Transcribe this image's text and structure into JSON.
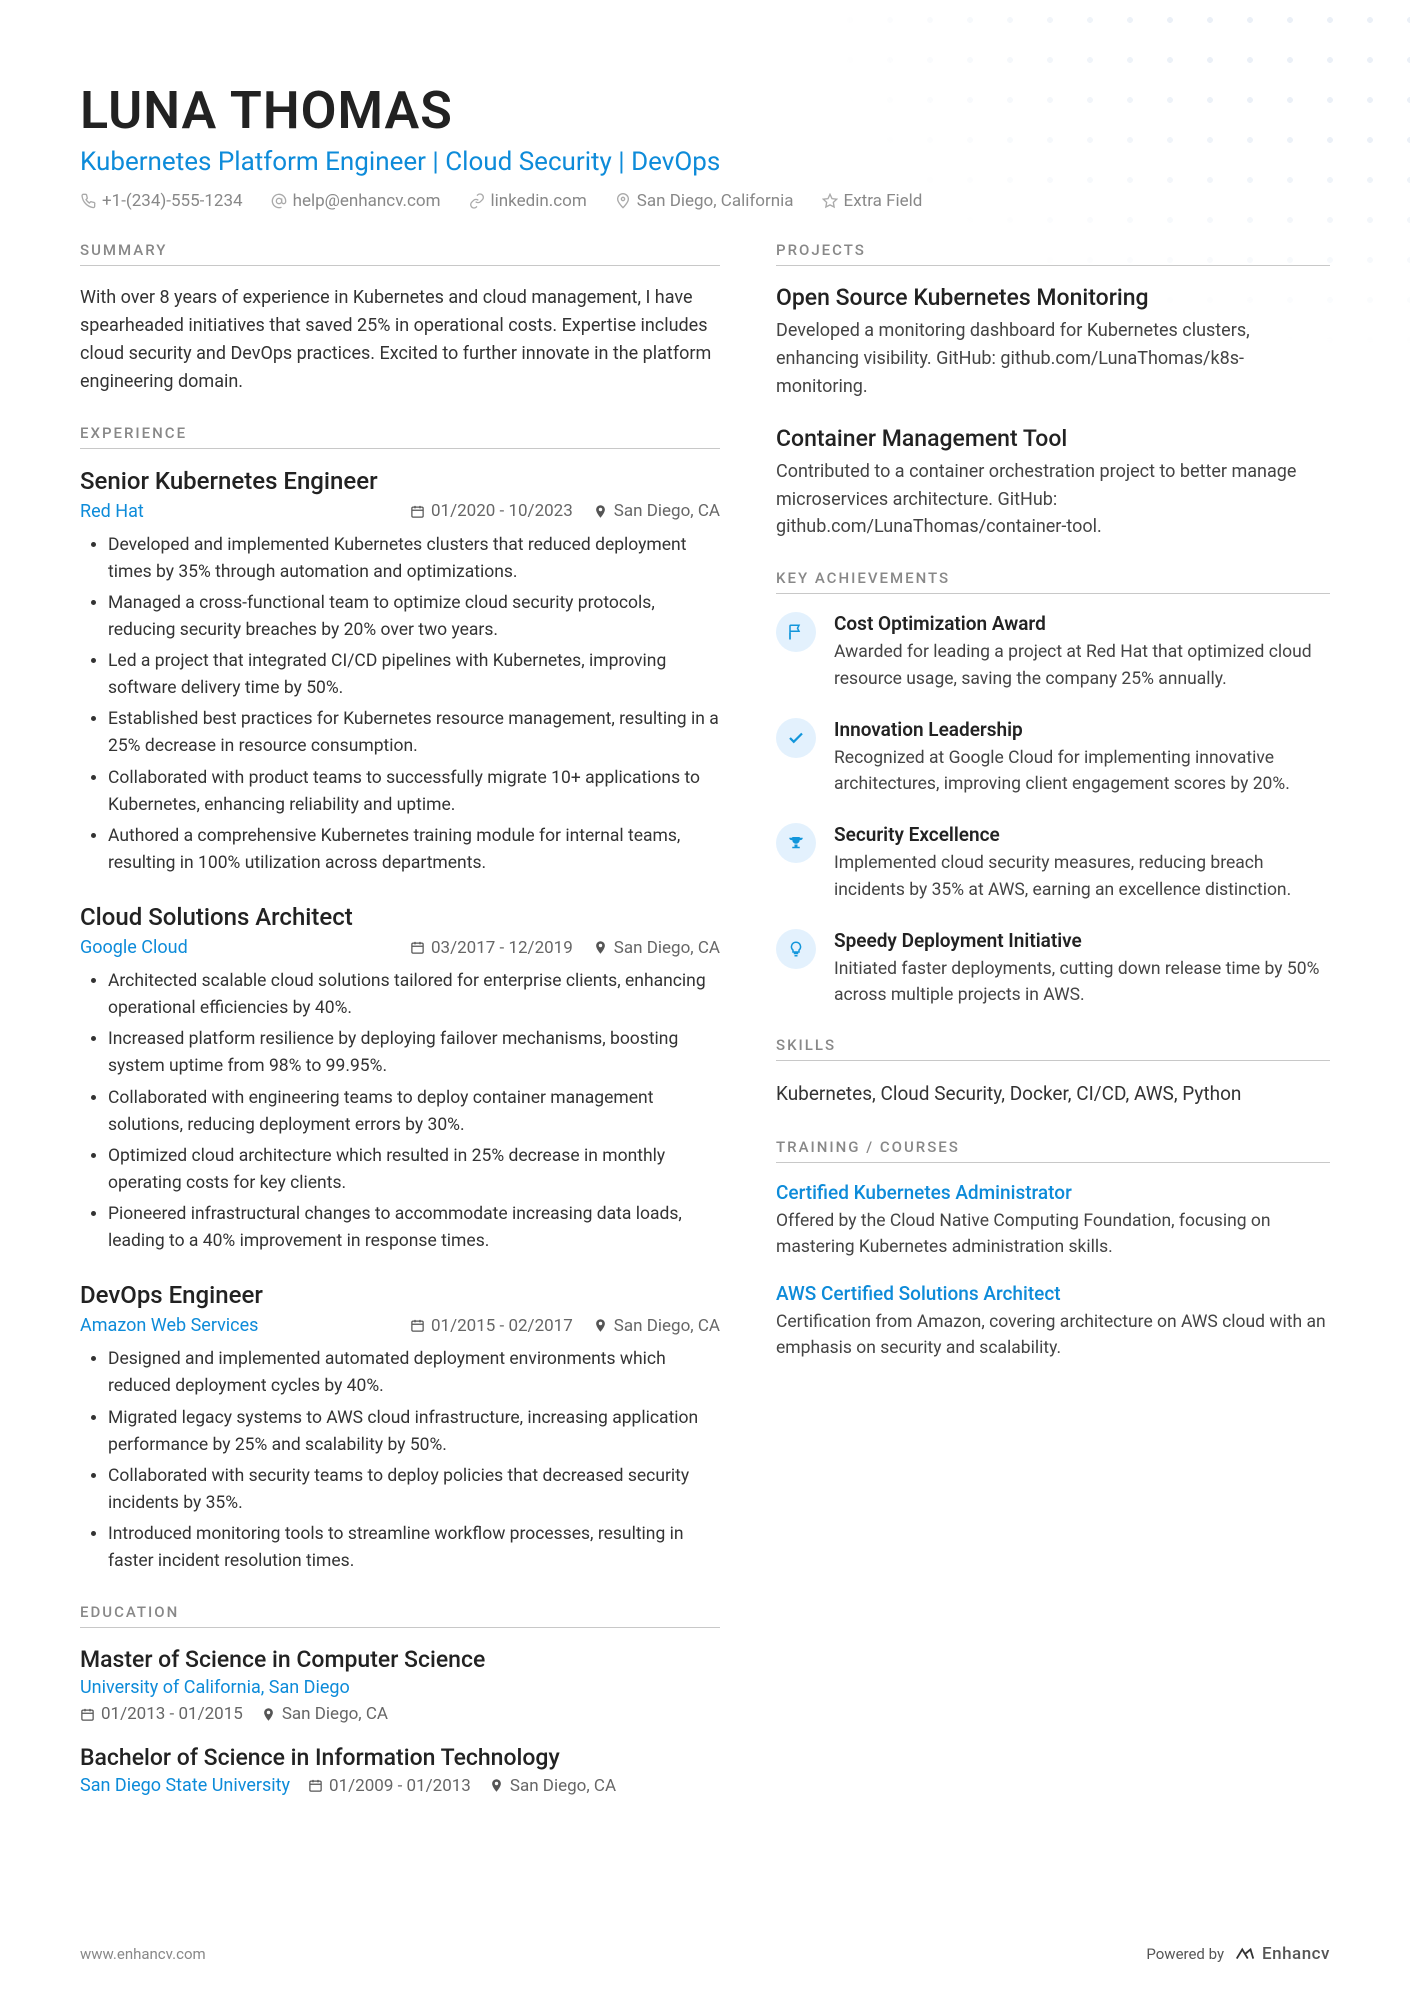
{
  "header": {
    "name": "LUNA THOMAS",
    "subtitle": "Kubernetes Platform Engineer | Cloud Security | DevOps",
    "contacts": {
      "phone": "+1-(234)-555-1234",
      "email": "help@enhancv.com",
      "linkedin": "linkedin.com",
      "location": "San Diego, California",
      "extra": "Extra Field"
    }
  },
  "sections": {
    "summary_label": "SUMMARY",
    "experience_label": "EXPERIENCE",
    "education_label": "EDUCATION",
    "projects_label": "PROJECTS",
    "achievements_label": "KEY ACHIEVEMENTS",
    "skills_label": "SKILLS",
    "training_label": "TRAINING / COURSES"
  },
  "summary": "With over 8 years of experience in Kubernetes and cloud management, I have spearheaded initiatives that saved 25% in operational costs. Expertise includes cloud security and DevOps practices. Excited to further innovate in the platform engineering domain.",
  "experience": [
    {
      "title": "Senior Kubernetes Engineer",
      "company": "Red Hat",
      "dates": "01/2020 - 10/2023",
      "location": "San Diego, CA",
      "bullets": [
        "Developed and implemented Kubernetes clusters that reduced deployment times by 35% through automation and optimizations.",
        "Managed a cross-functional team to optimize cloud security protocols, reducing security breaches by 20% over two years.",
        "Led a project that integrated CI/CD pipelines with Kubernetes, improving software delivery time by 50%.",
        "Established best practices for Kubernetes resource management, resulting in a 25% decrease in resource consumption.",
        "Collaborated with product teams to successfully migrate 10+ applications to Kubernetes, enhancing reliability and uptime.",
        "Authored a comprehensive Kubernetes training module for internal teams, resulting in 100% utilization across departments."
      ]
    },
    {
      "title": "Cloud Solutions Architect",
      "company": "Google Cloud",
      "dates": "03/2017 - 12/2019",
      "location": "San Diego, CA",
      "bullets": [
        "Architected scalable cloud solutions tailored for enterprise clients, enhancing operational efficiencies by 40%.",
        "Increased platform resilience by deploying failover mechanisms, boosting system uptime from 98% to 99.95%.",
        "Collaborated with engineering teams to deploy container management solutions, reducing deployment errors by 30%.",
        "Optimized cloud architecture which resulted in 25% decrease in monthly operating costs for key clients.",
        "Pioneered infrastructural changes to accommodate increasing data loads, leading to a 40% improvement in response times."
      ]
    },
    {
      "title": "DevOps Engineer",
      "company": "Amazon Web Services",
      "dates": "01/2015 - 02/2017",
      "location": "San Diego, CA",
      "bullets": [
        "Designed and implemented automated deployment environments which reduced deployment cycles by 40%.",
        "Migrated legacy systems to AWS cloud infrastructure, increasing application performance by 25% and scalability by 50%.",
        "Collaborated with security teams to deploy policies that decreased security incidents by 35%.",
        "Introduced monitoring tools to streamline workflow processes, resulting in faster incident resolution times."
      ]
    }
  ],
  "education": [
    {
      "degree": "Master of Science in Computer Science",
      "school": "University of California, San Diego",
      "dates": "01/2013 - 01/2015",
      "location": "San Diego, CA",
      "layout": "stacked"
    },
    {
      "degree": "Bachelor of Science in Information Technology",
      "school": "San Diego State University",
      "dates": "01/2009 - 01/2013",
      "location": "San Diego, CA",
      "layout": "inline"
    }
  ],
  "projects": [
    {
      "title": "Open Source Kubernetes Monitoring",
      "desc": "Developed a monitoring dashboard for Kubernetes clusters, enhancing visibility. GitHub: github.com/LunaThomas/k8s-monitoring."
    },
    {
      "title": "Container Management Tool",
      "desc": "Contributed to a container orchestration project to better manage microservices architecture. GitHub: github.com/LunaThomas/container-tool."
    }
  ],
  "achievements": [
    {
      "icon": "flag",
      "title": "Cost Optimization Award",
      "desc": "Awarded for leading a project at Red Hat that optimized cloud resource usage, saving the company 25% annually."
    },
    {
      "icon": "check",
      "title": "Innovation Leadership",
      "desc": "Recognized at Google Cloud for implementing innovative architectures, improving client engagement scores by 20%."
    },
    {
      "icon": "trophy",
      "title": "Security Excellence",
      "desc": "Implemented cloud security measures, reducing breach incidents by 35% at AWS, earning an excellence distinction."
    },
    {
      "icon": "bulb",
      "title": "Speedy Deployment Initiative",
      "desc": "Initiated faster deployments, cutting down release time by 50% across multiple projects in AWS."
    }
  ],
  "skills": "Kubernetes, Cloud Security, Docker, CI/CD, AWS, Python",
  "courses": [
    {
      "title": "Certified Kubernetes Administrator",
      "desc": "Offered by the Cloud Native Computing Foundation, focusing on mastering Kubernetes administration skills."
    },
    {
      "title": "AWS Certified Solutions Architect",
      "desc": "Certification from Amazon, covering architecture on AWS cloud with an emphasis on security and scalability."
    }
  ],
  "footer": {
    "url": "www.enhancv.com",
    "powered_by": "Powered by",
    "brand": "Enhancv"
  }
}
